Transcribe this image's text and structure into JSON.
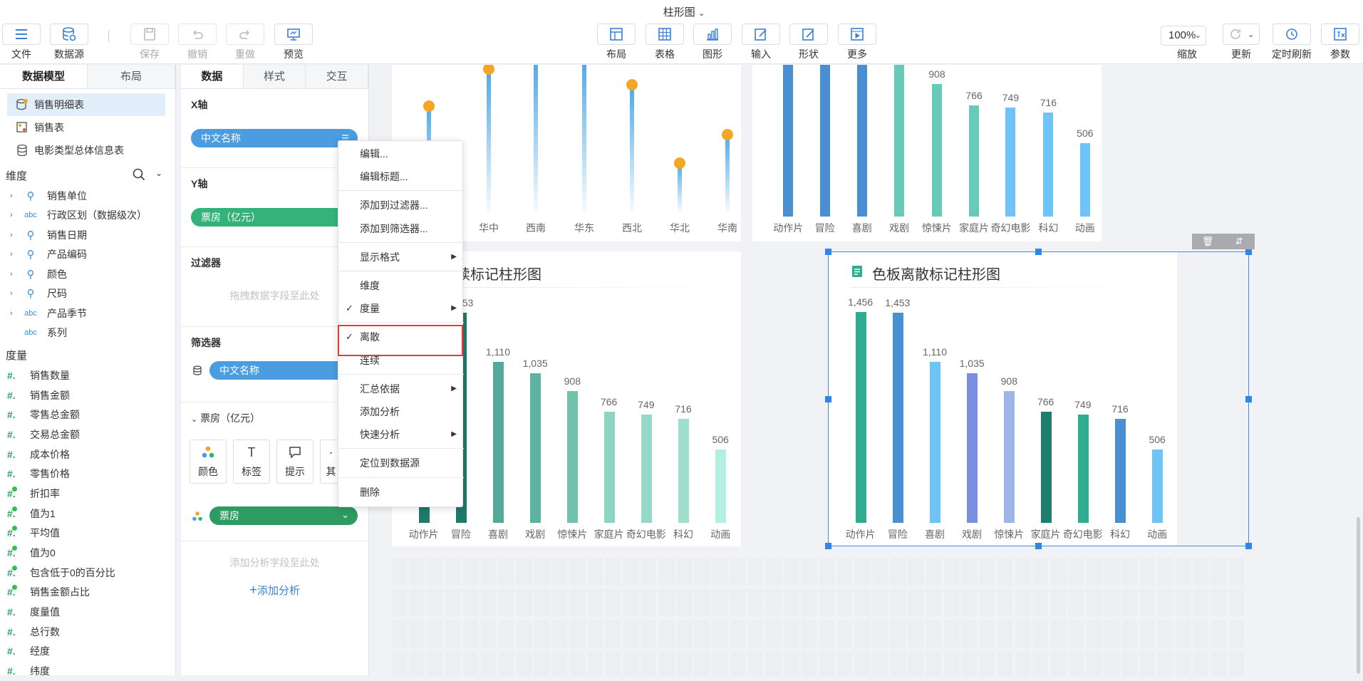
{
  "window": {
    "title": "柱形图"
  },
  "toolbar": {
    "left": [
      {
        "label": "文件",
        "icon": "menu-icon",
        "disabled": false
      },
      {
        "label": "数据源",
        "icon": "database-icon",
        "disabled": false
      },
      {
        "label": "保存",
        "icon": "save-icon",
        "disabled": true
      },
      {
        "label": "撤销",
        "icon": "undo-icon",
        "disabled": true
      },
      {
        "label": "重做",
        "icon": "redo-icon",
        "disabled": true
      },
      {
        "label": "预览",
        "icon": "preview-icon",
        "disabled": false
      }
    ],
    "center": [
      {
        "label": "布局",
        "icon": "layout-icon"
      },
      {
        "label": "表格",
        "icon": "table-icon"
      },
      {
        "label": "图形",
        "icon": "chart-icon"
      },
      {
        "label": "输入",
        "icon": "input-icon"
      },
      {
        "label": "形状",
        "icon": "shape-icon"
      },
      {
        "label": "更多",
        "icon": "more-icon"
      }
    ],
    "zoom_value": "100%",
    "right": [
      {
        "label": "缩放",
        "icon": ""
      },
      {
        "label": "更新",
        "icon": "refresh-icon"
      },
      {
        "label": "定时刷新",
        "icon": "clock-icon"
      },
      {
        "label": "参数",
        "icon": "param-icon"
      }
    ]
  },
  "left_panel": {
    "tabs": [
      "数据模型",
      "布局"
    ],
    "datasets": [
      "销售明细表",
      "销售表",
      "电影类型总体信息表"
    ],
    "dimension_header": "维度",
    "dimensions": [
      {
        "type": "geo",
        "name": "销售单位",
        "expandable": true
      },
      {
        "type": "abc",
        "name": "行政区划（数据级次）",
        "expandable": true
      },
      {
        "type": "geo",
        "name": "销售日期",
        "expandable": true
      },
      {
        "type": "geo",
        "name": "产品编码",
        "expandable": true
      },
      {
        "type": "geo",
        "name": "颜色",
        "expandable": true
      },
      {
        "type": "geo",
        "name": "尺码",
        "expandable": true
      },
      {
        "type": "abc",
        "name": "产品季节",
        "expandable": true
      },
      {
        "type": "abc",
        "name": "系列",
        "expandable": false
      }
    ],
    "measure_header": "度量",
    "measures": [
      {
        "name": "销售数量",
        "calc": false
      },
      {
        "name": "销售金额",
        "calc": false
      },
      {
        "name": "零售总金额",
        "calc": false
      },
      {
        "name": "交易总金额",
        "calc": false
      },
      {
        "name": "成本价格",
        "calc": false
      },
      {
        "name": "零售价格",
        "calc": false
      },
      {
        "name": "折扣率",
        "calc": true
      },
      {
        "name": "值为1",
        "calc": true
      },
      {
        "name": "平均值",
        "calc": true
      },
      {
        "name": "值为0",
        "calc": true
      },
      {
        "name": "包含低于0的百分比",
        "calc": true
      },
      {
        "name": "销售金额占比",
        "calc": true
      },
      {
        "name": "度量值",
        "calc": false
      },
      {
        "name": "总行数",
        "calc": false
      },
      {
        "name": "经度",
        "calc": false
      },
      {
        "name": "纬度",
        "calc": false
      }
    ]
  },
  "mid_panel": {
    "tabs": [
      "数据",
      "样式",
      "交互"
    ],
    "x_axis": {
      "title": "X轴",
      "field": "中文名称"
    },
    "y_axis": {
      "title": "Y轴",
      "field": "票房（亿元）"
    },
    "filter": {
      "title": "过滤器",
      "hint": "拖拽数据字段至此处"
    },
    "screen": {
      "title": "筛选器",
      "field": "中文名称"
    },
    "measure_section": {
      "title": "票房（亿元）"
    },
    "props": [
      "颜色",
      "标签",
      "提示",
      "其"
    ],
    "color_field": "票房",
    "analysis_hint": "添加分析字段至此处",
    "add_analysis": "添加分析"
  },
  "context_menu": {
    "items": [
      {
        "label": "编辑...",
        "checked": false,
        "submenu": false
      },
      {
        "label": "编辑标题...",
        "checked": false,
        "submenu": false
      },
      {
        "label": "添加到过滤器...",
        "checked": false,
        "submenu": false
      },
      {
        "label": "添加到筛选器...",
        "checked": false,
        "submenu": false
      },
      {
        "label": "显示格式",
        "checked": false,
        "submenu": true
      },
      {
        "label": "维度",
        "checked": false,
        "submenu": false
      },
      {
        "label": "度量",
        "checked": true,
        "submenu": true
      },
      {
        "label": "离散",
        "checked": true,
        "submenu": false
      },
      {
        "label": "连续",
        "checked": false,
        "submenu": false
      },
      {
        "label": "汇总依据",
        "checked": false,
        "submenu": true
      },
      {
        "label": "添加分析",
        "checked": false,
        "submenu": false
      },
      {
        "label": "快速分析",
        "checked": false,
        "submenu": true
      },
      {
        "label": "定位到数据源",
        "checked": false,
        "submenu": false
      },
      {
        "label": "删除",
        "checked": false,
        "submenu": false
      }
    ]
  },
  "cards": {
    "top_left_categories": [
      "华中",
      "西南",
      "华东",
      "西北",
      "华北",
      "华南"
    ],
    "top_right_values": [
      "908",
      "766",
      "749",
      "716",
      "506"
    ],
    "top_right_categories": [
      "动作片",
      "冒险",
      "喜剧",
      "戏剧",
      "惊悚片",
      "家庭片",
      "奇幻电影",
      "科幻",
      "动画"
    ],
    "bottom_left_title": "连续标记柱形图",
    "bottom_right_title": "色板离散标记柱形图",
    "card_tools": [
      "trash-icon",
      "swap-icon"
    ]
  },
  "chart_data": [
    {
      "type": "bar",
      "title": "连续标记柱形图",
      "categories": [
        "动作片",
        "冒险",
        "喜剧",
        "戏剧",
        "惊悚片",
        "家庭片",
        "奇幻电影",
        "科幻",
        "动画"
      ],
      "values": [
        1456,
        1453,
        1110,
        1035,
        908,
        766,
        749,
        716,
        506
      ],
      "labels": [
        "1,456",
        "1,453",
        "1,110",
        "1,035",
        "908",
        "766",
        "749",
        "716",
        "506"
      ],
      "colors": [
        "#1f7a68",
        "#1f7a68",
        "#53aa98",
        "#5cb39f",
        "#70c2ad",
        "#8dd5c3",
        "#96d9c9",
        "#9fdfcd",
        "#b4f0e1"
      ]
    },
    {
      "type": "bar",
      "title": "色板离散标记柱形图",
      "categories": [
        "动作片",
        "冒险",
        "喜剧",
        "戏剧",
        "惊悚片",
        "家庭片",
        "奇幻电影",
        "科幻",
        "动画"
      ],
      "values": [
        1456,
        1453,
        1110,
        1035,
        908,
        766,
        749,
        716,
        506
      ],
      "labels": [
        "1,456",
        "1,453",
        "1,110",
        "1,035",
        "908",
        "766",
        "749",
        "716",
        "506"
      ],
      "colors": [
        "#2fae8f",
        "#4a8fd1",
        "#6ec3f7",
        "#7a8fe0",
        "#9fb5ea",
        "#1f7e6f",
        "#2fae8f",
        "#4a8fd1",
        "#6ec3f7"
      ]
    }
  ]
}
